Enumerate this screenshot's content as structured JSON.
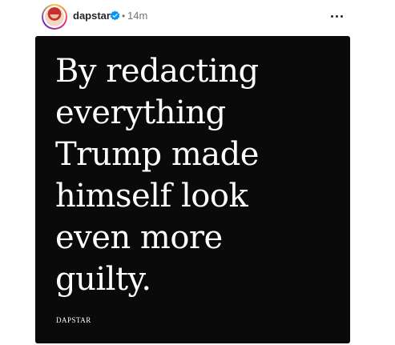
{
  "header": {
    "username": "dapstar",
    "separator": "•",
    "timestamp": "14m",
    "verified_icon": "verified-badge-icon",
    "more_icon": "more-options-icon"
  },
  "post": {
    "quote_text": "By redacting\neverything\nTrump made\nhimself look\neven more\nguilty.",
    "signature": "DAPSTAR"
  },
  "colors": {
    "media_background": "#0a0a0a",
    "verified_blue": "#0095f6",
    "username_text": "#262626",
    "muted_text": "#737373"
  }
}
